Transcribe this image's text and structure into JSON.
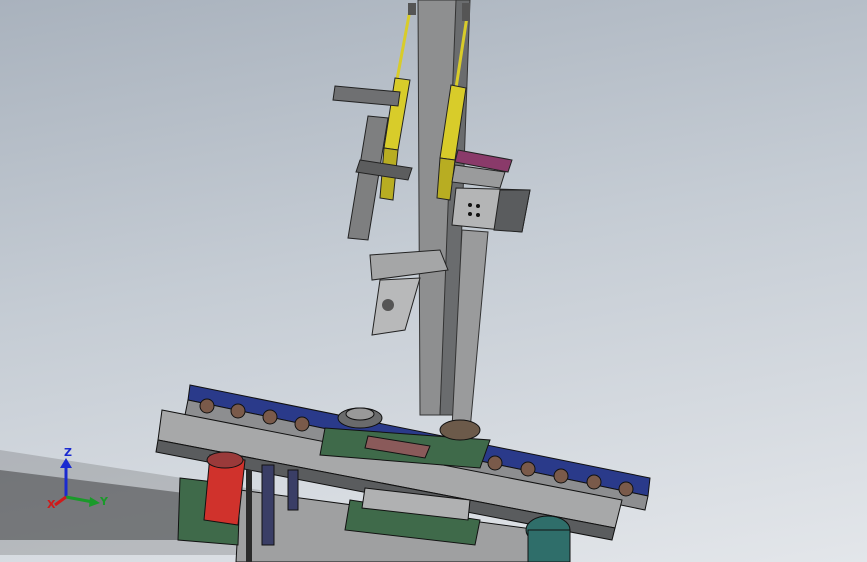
{
  "viewport": {
    "background_top": "#a9b2bd",
    "background_bottom": "#e3e6ea",
    "model": "cad-assembly-machine"
  },
  "colors": {
    "frame_gray": "#8c8e90",
    "frame_dark": "#4a4c4f",
    "cylinder_yellow": "#d8cc2a",
    "belt_blue": "#2a3a8a",
    "plate_green": "#3f6a4a",
    "motor_red": "#d0322c",
    "accent_magenta": "#8a3a6a",
    "roller_brown": "#7a5a4a",
    "motor_teal": "#2f6e6a"
  },
  "triad": {
    "z_label": "Z",
    "y_label": "Y",
    "x_label": "X",
    "z_color": "#1a2ad0",
    "y_color": "#1a9a2a",
    "x_color": "#d01a1a"
  }
}
